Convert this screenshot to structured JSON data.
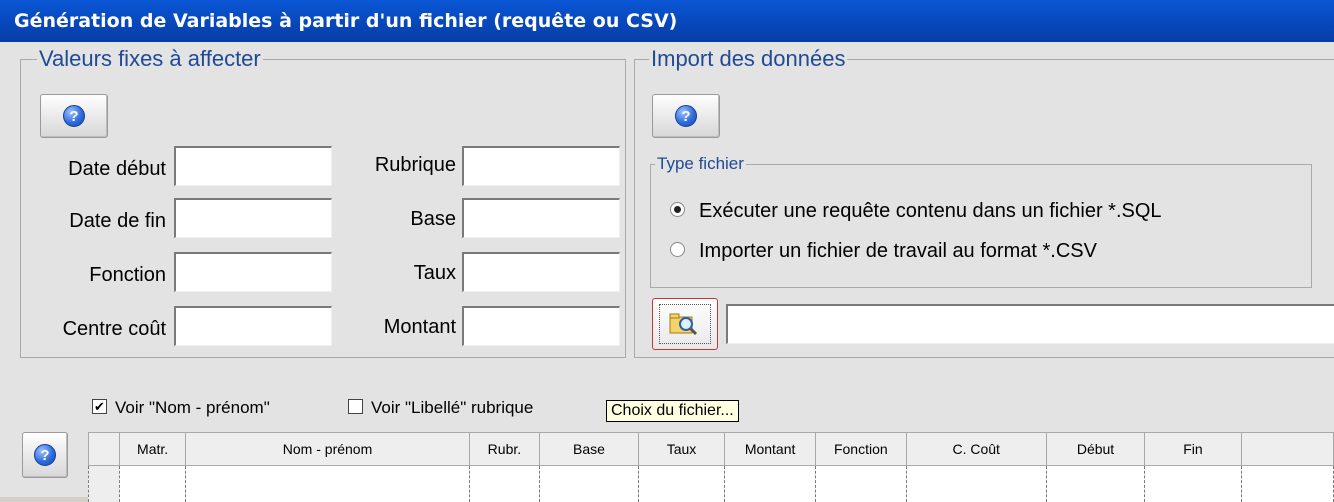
{
  "window": {
    "title": "Génération de Variables à partir d'un fichier (requête ou CSV)"
  },
  "fixed_values": {
    "legend": "Valeurs fixes à affecter",
    "help_icon": "?",
    "labels": {
      "date_debut": "Date début",
      "date_fin": "Date de fin",
      "fonction": "Fonction",
      "centre_cout": "Centre coût",
      "rubrique": "Rubrique",
      "base": "Base",
      "taux": "Taux",
      "montant": "Montant"
    }
  },
  "import": {
    "legend": "Import des données",
    "help_icon": "?",
    "file_type": {
      "legend": "Type fichier",
      "options": [
        "Exécuter une requête contenu dans un fichier *.SQL",
        "Importer un fichier de travail au format *.CSV"
      ],
      "selected_index": 0
    },
    "file_button_icon": "folder-search-icon",
    "file_path": "",
    "tooltip": "Choix du fichier..."
  },
  "options": {
    "voir_nom": {
      "label": "Voir \"Nom - prénom\"",
      "checked": true
    },
    "voir_libelle": {
      "label": "Voir \"Libellé\" rubrique",
      "checked": false
    }
  },
  "grid": {
    "help_icon": "?",
    "columns": [
      "Matr.",
      "Nom - prénom",
      "Rubr.",
      "Base",
      "Taux",
      "Montant",
      "Fonction",
      "C. Coût",
      "Début",
      "Fin"
    ]
  }
}
